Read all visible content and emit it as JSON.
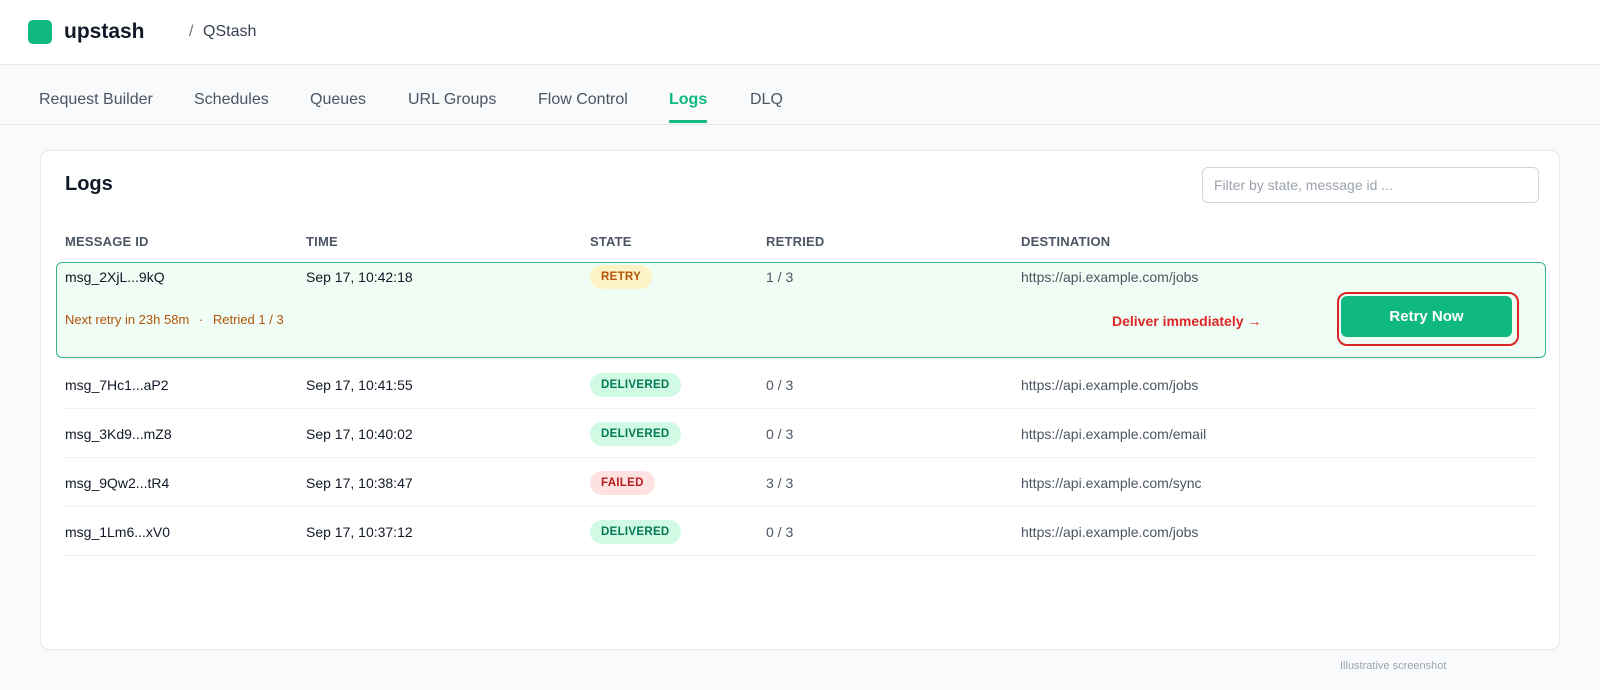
{
  "app": {
    "brand": "upstash",
    "breadcrumb_sep": "/",
    "breadcrumb": "QStash"
  },
  "colors": {
    "accent": "#10b981",
    "annotation": "#dc2626",
    "retry": "#b45309",
    "failed": "#b91c1c"
  },
  "tabs": [
    {
      "label": "Request Builder",
      "active": false
    },
    {
      "label": "Schedules",
      "active": false
    },
    {
      "label": "Queues",
      "active": false
    },
    {
      "label": "URL Groups",
      "active": false
    },
    {
      "label": "Flow Control",
      "active": false
    },
    {
      "label": "Logs",
      "active": true
    },
    {
      "label": "DLQ",
      "active": false
    }
  ],
  "logs": {
    "title": "Logs",
    "filter_placeholder": "Filter by state, message id ...",
    "columns": [
      "MESSAGE ID",
      "TIME",
      "STATE",
      "RETRIED",
      "DESTINATION"
    ],
    "rows": [
      {
        "id": "msg_2XjL...9kQ",
        "time": "Sep 17, 10:42:18",
        "state": "RETRY",
        "retried": "1 / 3",
        "destination": "https://api.example.com/jobs"
      },
      {
        "id": "msg_7Hc1...aP2",
        "time": "Sep 17, 10:41:55",
        "state": "DELIVERED",
        "retried": "0 / 3",
        "destination": "https://api.example.com/jobs"
      },
      {
        "id": "msg_3Kd9...mZ8",
        "time": "Sep 17, 10:40:02",
        "state": "DELIVERED",
        "retried": "0 / 3",
        "destination": "https://api.example.com/email"
      },
      {
        "id": "msg_9Qw2...tR4",
        "time": "Sep 17, 10:38:47",
        "state": "FAILED",
        "retried": "3 / 3",
        "destination": "https://api.example.com/sync"
      },
      {
        "id": "msg_1Lm6...xV0",
        "time": "Sep 17, 10:37:12",
        "state": "DELIVERED",
        "retried": "0 / 3",
        "destination": "https://api.example.com/jobs"
      }
    ],
    "expanded": {
      "next_retry": "Next retry in 23h 58m",
      "separator": "·",
      "retried_note": "Retried 1 / 3",
      "annotation": "Deliver immediately →",
      "retry_button": "Retry Now"
    }
  },
  "footnote": "Illustrative screenshot"
}
